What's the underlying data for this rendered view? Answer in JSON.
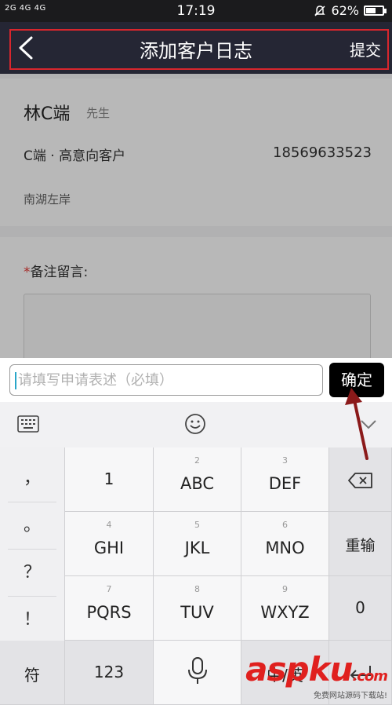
{
  "status_bar": {
    "signal": "2G 4G 4G",
    "time": "17:19",
    "battery": "62%",
    "battery_level": 0.62
  },
  "nav": {
    "title": "添加客户日志",
    "submit_label": "提交"
  },
  "customer": {
    "name": "林C端",
    "honorific": "先生",
    "type": "C端 · 高意向客户",
    "phone": "18569633523",
    "area": "南湖左岸"
  },
  "remark": {
    "required_mark": "*",
    "label": "备注留言:"
  },
  "input": {
    "placeholder": "请填写申请表述（必填）",
    "value": "",
    "confirm_label": "确定"
  },
  "keyboard": {
    "punctuation": [
      "，",
      "。",
      "？",
      "！"
    ],
    "keys": [
      {
        "num": "",
        "label": "1"
      },
      {
        "num": "2",
        "label": "ABC"
      },
      {
        "num": "3",
        "label": "DEF"
      },
      {
        "num": "4",
        "label": "GHI"
      },
      {
        "num": "5",
        "label": "JKL"
      },
      {
        "num": "6",
        "label": "MNO"
      },
      {
        "num": "7",
        "label": "PQRS"
      },
      {
        "num": "8",
        "label": "TUV"
      },
      {
        "num": "9",
        "label": "WXYZ"
      }
    ],
    "reenter_label": "重输",
    "zero_label": "0",
    "symbol_label": "符",
    "num_label": "123",
    "lang_label": "中/英"
  },
  "watermark": {
    "logo": "aspku",
    "domain": ".com",
    "tagline": "免费网站源码下载站!"
  },
  "colors": {
    "nav_bg": "#252634",
    "highlight": "#d8262d",
    "arrow": "#8b1a1a"
  }
}
